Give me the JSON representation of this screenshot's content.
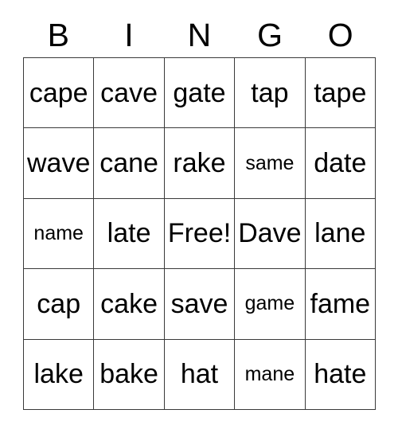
{
  "card": {
    "title": "BINGO",
    "header_letters": [
      "B",
      "I",
      "N",
      "G",
      "O"
    ],
    "free_space_label": "Free!",
    "free_space_position": {
      "row": 2,
      "col": 2
    },
    "grid_size": "5x5",
    "colors": {
      "background": "#ffffff",
      "border": "#3a3a3a",
      "text": "#000000"
    },
    "rows": [
      {
        "cells": [
          {
            "text": "cape",
            "size": "normal"
          },
          {
            "text": "cave",
            "size": "normal"
          },
          {
            "text": "gate",
            "size": "normal"
          },
          {
            "text": "tap",
            "size": "normal"
          },
          {
            "text": "tape",
            "size": "normal"
          }
        ]
      },
      {
        "cells": [
          {
            "text": "wave",
            "size": "normal"
          },
          {
            "text": "cane",
            "size": "normal"
          },
          {
            "text": "rake",
            "size": "normal"
          },
          {
            "text": "same",
            "size": "small"
          },
          {
            "text": "date",
            "size": "normal"
          }
        ]
      },
      {
        "cells": [
          {
            "text": "name",
            "size": "small"
          },
          {
            "text": "late",
            "size": "normal"
          },
          {
            "text": "Free!",
            "size": "normal"
          },
          {
            "text": "Dave",
            "size": "normal"
          },
          {
            "text": "lane",
            "size": "normal"
          }
        ]
      },
      {
        "cells": [
          {
            "text": "cap",
            "size": "normal"
          },
          {
            "text": "cake",
            "size": "normal"
          },
          {
            "text": "save",
            "size": "normal"
          },
          {
            "text": "game",
            "size": "small"
          },
          {
            "text": "fame",
            "size": "normal"
          }
        ]
      },
      {
        "cells": [
          {
            "text": "lake",
            "size": "normal"
          },
          {
            "text": "bake",
            "size": "normal"
          },
          {
            "text": "hat",
            "size": "normal"
          },
          {
            "text": "mane",
            "size": "small"
          },
          {
            "text": "hate",
            "size": "normal"
          }
        ]
      }
    ]
  }
}
